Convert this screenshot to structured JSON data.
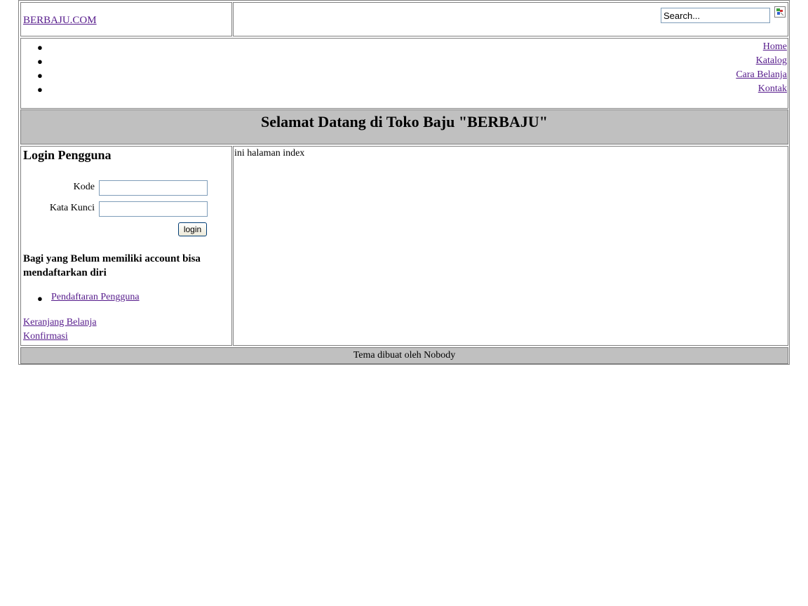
{
  "header": {
    "logo_text": "BERBAJU.COM",
    "search_value": "Search...",
    "search_icon": "broken-image-icon"
  },
  "nav": {
    "items": [
      {
        "label": "Home"
      },
      {
        "label": "Katalog"
      },
      {
        "label": "Cara Belanja"
      },
      {
        "label": "Kontak"
      }
    ],
    "bullet": "●"
  },
  "welcome": {
    "title": "Selamat Datang di Toko Baju \"BERBAJU\""
  },
  "sidebar": {
    "heading": "Login Pengguna",
    "kode_label": "Kode",
    "kata_kunci_label": "Kata Kunci",
    "kode_value": "",
    "kata_kunci_value": "",
    "login_label": "login",
    "note": "Bagi yang Belum memiliki account bisa mendaftarkan diri",
    "register_link": "Pendaftaran Pengguna",
    "cart_link": "Keranjang Belanja",
    "confirm_link": "Konfirmasi"
  },
  "main": {
    "text": "ini halaman index"
  },
  "footer": {
    "text": "Tema dibuat oleh Nobody"
  },
  "colors": {
    "link": "#551a8b",
    "panel_gray": "#c0c0c0",
    "border": "#808080"
  }
}
